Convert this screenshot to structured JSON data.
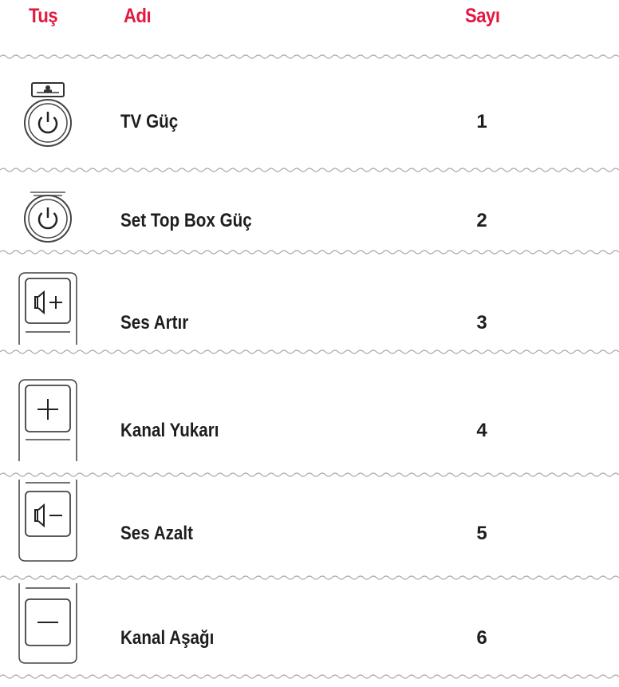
{
  "header": {
    "key_label": "Tuş",
    "name_label": "Adı",
    "number_label": "Sayı"
  },
  "colors": {
    "header": "#e3183f",
    "text": "#1e1e1e",
    "divider": "#aaaaaa",
    "icon": "#333333"
  },
  "rows": [
    {
      "name": "TV Güç",
      "number": "1",
      "icon": "tv-power-icon"
    },
    {
      "name": "Set Top Box Güç",
      "number": "2",
      "icon": "set-top-box-power-icon"
    },
    {
      "name": "Ses Artır",
      "number": "3",
      "icon": "volume-up-icon"
    },
    {
      "name": "Kanal Yukarı",
      "number": "4",
      "icon": "channel-up-icon"
    },
    {
      "name": "Ses Azalt",
      "number": "5",
      "icon": "volume-down-icon"
    },
    {
      "name": "Kanal Aşağı",
      "number": "6",
      "icon": "channel-down-icon"
    }
  ]
}
